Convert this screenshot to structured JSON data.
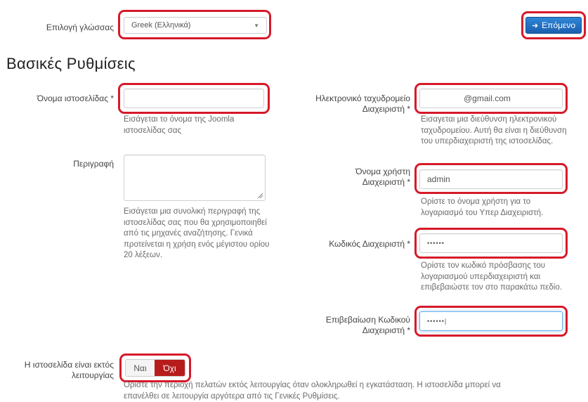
{
  "language": {
    "label": "Επιλογή γλώσσας",
    "selected": "Greek (Ελληνικά)"
  },
  "next_button": {
    "label": "Επόμενο",
    "icon": "arrow-right-icon"
  },
  "section_title": "Βασικές Ρυθμίσεις",
  "site_name": {
    "label": "Όνομα ιστοσελίδας *",
    "value": "",
    "help": [
      "Εισάγεται το όνομα της Joomla",
      "ιστοσελίδας σας"
    ]
  },
  "description": {
    "label": "Περιγραφή",
    "value": "",
    "help": [
      "Εισάγεται μια συνολική περιγραφή της",
      "ιστοσελίδας σας που θα χρησιμοποιηθεί",
      "από τις μηχανές αναζήτησης. Γενικά",
      "προτείνεται η χρήση ενός μέγιστου ορίου",
      "20 λέξεων."
    ]
  },
  "admin_email": {
    "label": [
      "Ηλεκτρονικό ταχυδρομείο",
      "Διαχειριστή *"
    ],
    "value": "@gmail.com",
    "help": [
      "Εισαγεται μια διεύθυνση ηλεκτρονικού",
      "ταχυδρομείου. Αυτή θα είναι η διεύθυνση",
      "του υπερδιαχειριστή της ιστοσελίδας."
    ]
  },
  "admin_username": {
    "label": [
      "Όνομα χρήστη",
      "Διαχειριστή *"
    ],
    "value": "admin",
    "help": [
      "Ορίστε το όνομα χρήστη για το",
      "λογαριασμό του Υπερ Διαχειριστή."
    ]
  },
  "admin_password": {
    "label": "Κωδικός Διαχειριστή *",
    "value": "••••••",
    "help": [
      "Ορίστε τον κωδικό πρόσβασης του",
      "λογαριασμού υπερδιαχειριστή και",
      "επιβεβαιώστε τον στο παρακάτω πεδίο."
    ]
  },
  "confirm_password": {
    "label": [
      "Επιβεβαίωση Κωδικού",
      "Διαχειριστή *"
    ],
    "value": "••••••|"
  },
  "offline": {
    "label": [
      "Η ιστοσελίδα είναι εκτός",
      "λειτουργίας"
    ],
    "yes": "Ναι",
    "no": "Όχι",
    "selected": "no",
    "help": [
      "Ορίστε την περιοχή πελατών εκτός λειτουργίας όταν ολοκληρωθεί η εγκατάσταση. Η ιστοσελίδα μπορεί να",
      "επανέλθει σε λειτουργία αργότερα από τις Γενικές Ρυθμίσεις."
    ]
  },
  "colors": {
    "highlight": "#d61a2a",
    "primary": "#1a5fae",
    "active_toggle": "#b71c1c"
  }
}
